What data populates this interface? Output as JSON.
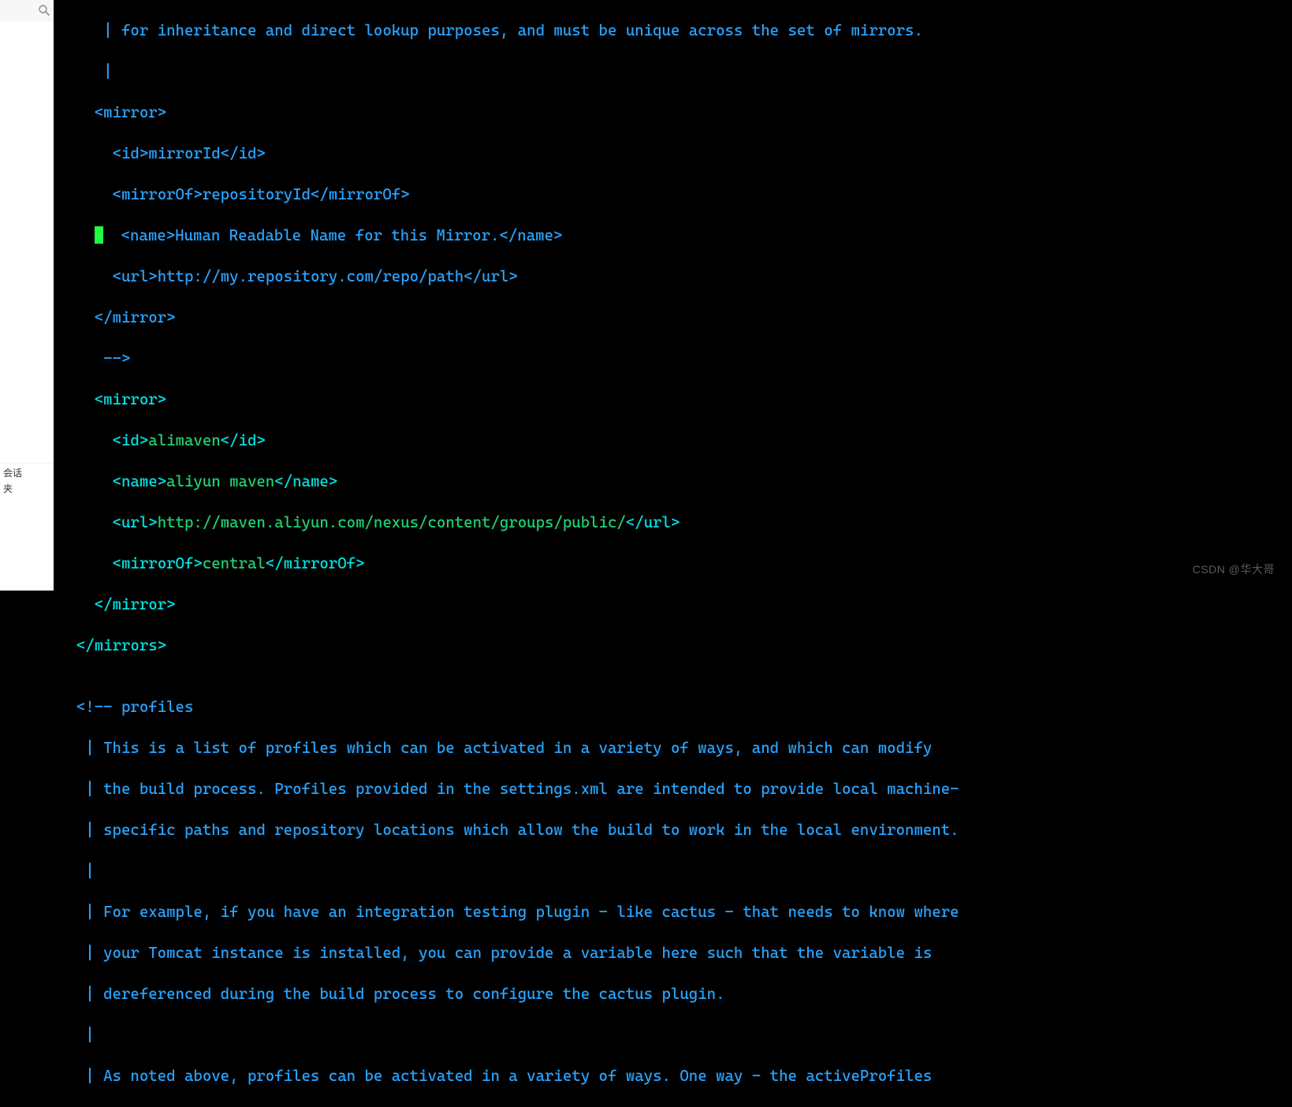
{
  "sidebar": {
    "search_placeholder": "",
    "label1": "会话",
    "label2": "夹"
  },
  "watermark": "CSDN @华大哥",
  "code": {
    "l01": "     | for inheritance and direct lookup purposes, and must be unique across the set of mirrors.",
    "l02": "     |",
    "l03_a": "    ",
    "l03_b": "<mirror>",
    "l04_a": "      ",
    "l04_b": "<id>",
    "l04_c": "mirrorId",
    "l04_d": "</id>",
    "l05_a": "      ",
    "l05_b": "<mirrorOf>",
    "l05_c": "repositoryId",
    "l05_d": "</mirrorOf>",
    "l06_a": "    ",
    "l06_b": "  ",
    "l06_c": "<name>",
    "l06_d": "Human Readable Name for this Mirror.",
    "l06_e": "</name>",
    "l07_a": "      ",
    "l07_b": "<url>",
    "l07_c": "http://my.repository.com/repo/path",
    "l07_d": "</url>",
    "l08_a": "    ",
    "l08_b": "</mirror>",
    "l09": "     -->",
    "l10_a": "    ",
    "l10_b": "<mirror>",
    "l11_a": "      ",
    "l11_b": "<id>",
    "l11_c": "alimaven",
    "l11_d": "</id>",
    "l12_a": "      ",
    "l12_b": "<name>",
    "l12_c": "aliyun maven",
    "l12_d": "</name>",
    "l13_a": "      ",
    "l13_b": "<url>",
    "l13_c": "http://maven.aliyun.com/nexus/content/groups/public/",
    "l13_d": "</url>",
    "l14_a": "      ",
    "l14_b": "<mirrorOf>",
    "l14_c": "central",
    "l14_d": "</mirrorOf>",
    "l15_a": "    ",
    "l15_b": "</mirror>",
    "l16_a": "  ",
    "l16_b": "</mirrors>",
    "l17": "",
    "l18": "  <!-- profiles",
    "l19": "   | This is a list of profiles which can be activated in a variety of ways, and which can modify",
    "l20": "   | the build process. Profiles provided in the settings.xml are intended to provide local machine-",
    "l21": "   | specific paths and repository locations which allow the build to work in the local environment.",
    "l22": "   |",
    "l23": "   | For example, if you have an integration testing plugin - like cactus - that needs to know where",
    "l24": "   | your Tomcat instance is installed, you can provide a variable here such that the variable is",
    "l25": "   | dereferenced during the build process to configure the cactus plugin.",
    "l26": "   |",
    "l27": "   | As noted above, profiles can be activated in a variety of ways. One way - the activeProfiles"
  }
}
